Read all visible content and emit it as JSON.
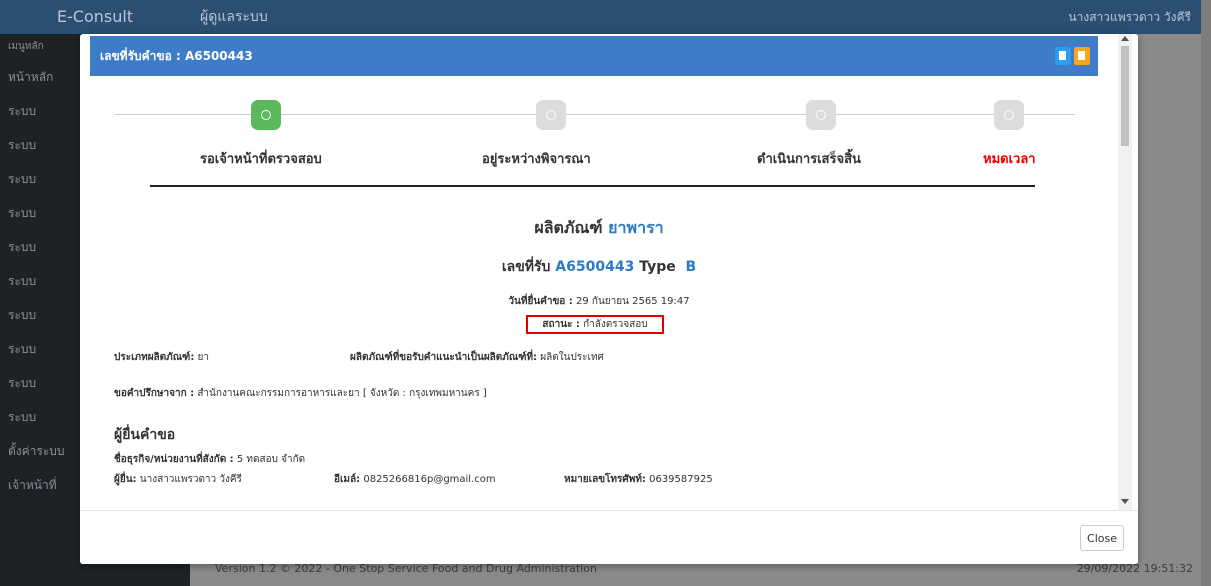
{
  "app": {
    "brand": "E-Consult",
    "menu_title": "ผู้ดูแลระบบ",
    "user_name": "นางสาวแพรวดาว วังคีรี",
    "sidebar": [
      "หน้าหลัก",
      "ระบบ",
      "ระบบ",
      "ระบบ",
      "ระบบ",
      "ระบบ",
      "ระบบ",
      "ระบบ",
      "ระบบ",
      "ระบบ",
      "ระบบ",
      "ตั้งค่าระบบ",
      "เจ้าหน้าที่"
    ],
    "footer_version": "Version 1.2 © 2022 - One Stop Service Food and Drug Administration",
    "footer_time": "29/09/2022 19:51:32"
  },
  "modal": {
    "title": "เลขที่รับคำขอ : A6500443",
    "steps": [
      {
        "label": "รอเจ้าหน้าที่ตรวจสอบ",
        "active": true
      },
      {
        "label": "อยู่ระหว่างพิจารณา",
        "active": false
      },
      {
        "label": "ดำเนินการเสร็จสิ้น",
        "active": false
      },
      {
        "label": "หมดเวลา",
        "active": false,
        "color": "#e00000"
      }
    ],
    "product_prefix": "ผลิตภัณฑ์",
    "product_name": "ยาพารา",
    "receipt_prefix": "เลขที่รับ",
    "receipt_no": "A6500443",
    "type_label": "Type",
    "type_value": "B",
    "submit_date_label": "วันที่ยื่นคำขอ :",
    "submit_date": "29 กันยายน 2565 19:47",
    "status_label": "สถานะ :",
    "status_value": "กำลังตรวจสอบ",
    "product_type_label": "ประเภทผลิตภัณฑ์:",
    "product_type": "ยา",
    "advice_product_label": "ผลิตภัณฑ์ที่ขอรับคำแนะนำเป็นผลิตภัณฑ์ที่:",
    "advice_product": "ผลิตในประเทศ",
    "consult_from_label": "ขอคำปรึกษาจาก :",
    "consult_from": "สำนักงานคณะกรรมการอาหารและยา [ จังหวัด : กรุงเทพมหานคร ]",
    "applicant_section": "ผู้ยื่นคำขอ",
    "business_label": "ชื่อธุรกิจ/หน่วยงานที่สังกัด :",
    "business": "5 ทดสอบ จำกัด",
    "applicant_label": "ผู้ยื่น:",
    "applicant": "นางสาวแพรวดาว วังคีรี",
    "email_label": "อีเมล์:",
    "email": "0825266816p@gmail.com",
    "phone_label": "หมายเลขโทรศัพท์:",
    "phone": "0639587925",
    "close_label": "Close"
  }
}
